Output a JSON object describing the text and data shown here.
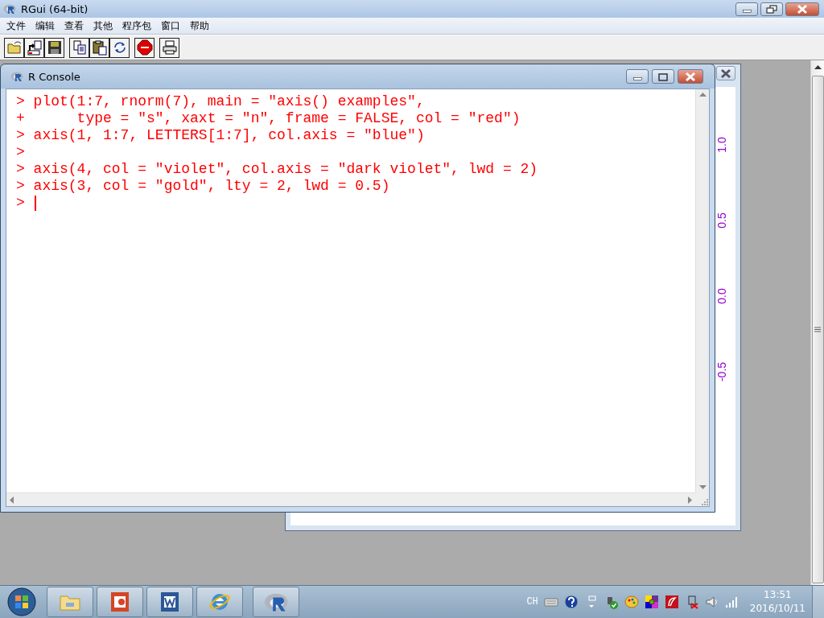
{
  "window": {
    "title": "RGui (64-bit)"
  },
  "menu": [
    "文件",
    "编辑",
    "查看",
    "其他",
    "程序包",
    "窗口",
    "帮助"
  ],
  "plot_window": {
    "axis_labels": [
      "1.0",
      "0.5",
      "0.0",
      "-0.5"
    ]
  },
  "console": {
    "title": "R Console",
    "lines": [
      "> plot(1:7, rnorm(7), main = \"axis() examples\",",
      "+      type = \"s\", xaxt = \"n\", frame = FALSE, col = \"red\")",
      "> axis(1, 1:7, LETTERS[1:7], col.axis = \"blue\")",
      ">",
      "> axis(4, col = \"violet\", col.axis = \"dark violet\", lwd = 2)",
      "> axis(3, col = \"gold\", lty = 2, lwd = 0.5)",
      ">"
    ]
  },
  "taskbar": {
    "language": "CH",
    "time": "13:51",
    "date": "2016/10/11"
  }
}
